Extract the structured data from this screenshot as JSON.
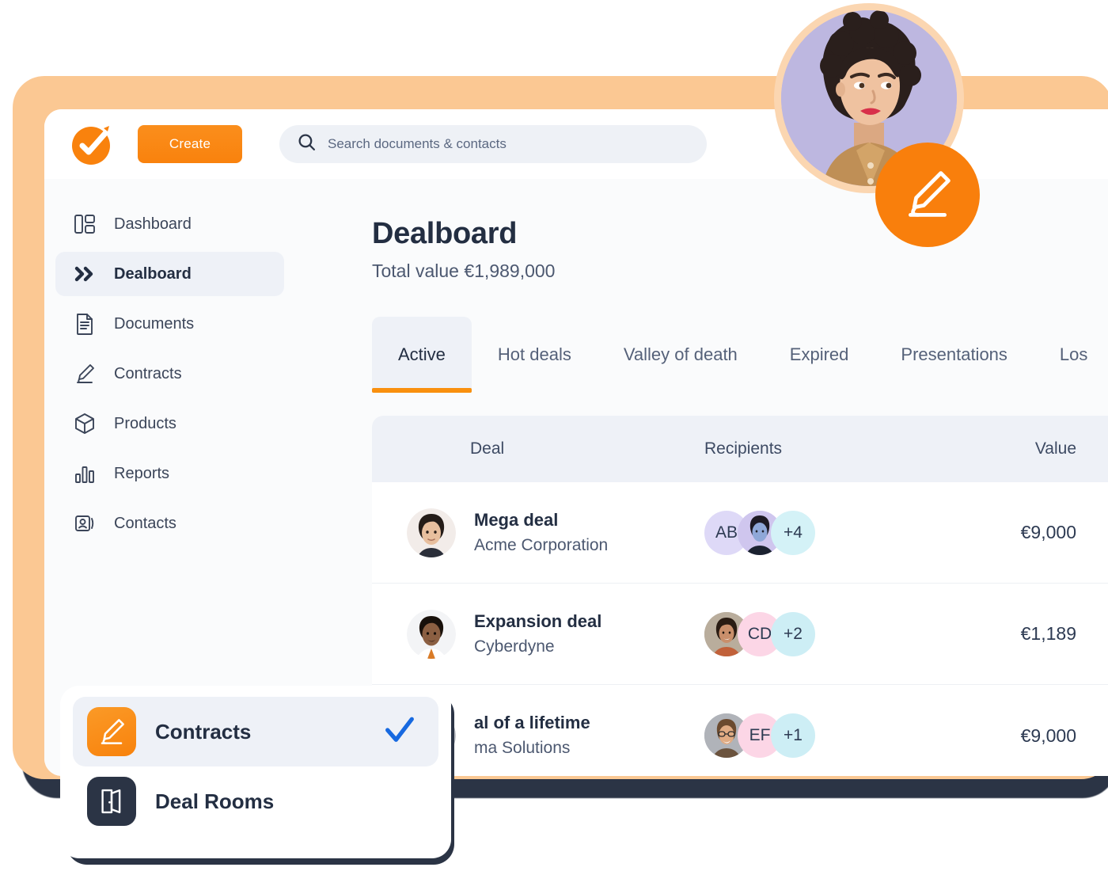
{
  "brand": {
    "accent_orange": "#f9820d",
    "frame_peach": "#fbc893",
    "dark_navy": "#2b3445",
    "logo_name": "check-logo"
  },
  "topbar": {
    "create_label": "Create",
    "search": {
      "placeholder": "Search documents & contacts",
      "icon": "search-icon"
    },
    "avatar_alt": "user-avatar",
    "fab_icon": "signature-pencil-icon"
  },
  "sidebar": {
    "items": [
      {
        "label": "Dashboard",
        "icon": "dashboard-icon",
        "active": false
      },
      {
        "label": "Dealboard",
        "icon": "chevrons-right-icon",
        "active": true
      },
      {
        "label": "Documents",
        "icon": "document-icon",
        "active": false
      },
      {
        "label": "Contracts",
        "icon": "signature-pencil-icon",
        "active": false
      },
      {
        "label": "Products",
        "icon": "cube-icon",
        "active": false
      },
      {
        "label": "Reports",
        "icon": "bar-chart-icon",
        "active": false
      },
      {
        "label": "Contacts",
        "icon": "contact-card-icon",
        "active": false
      }
    ]
  },
  "main": {
    "title": "Dealboard",
    "subtitle": "Total value €1,989,000",
    "tabs": [
      {
        "label": "Active",
        "active": true
      },
      {
        "label": "Hot deals",
        "active": false
      },
      {
        "label": "Valley of death",
        "active": false
      },
      {
        "label": "Expired",
        "active": false
      },
      {
        "label": "Presentations",
        "active": false
      },
      {
        "label": "Los",
        "active": false
      }
    ],
    "table": {
      "columns": [
        "Deal",
        "Recipients",
        "Value"
      ],
      "rows": [
        {
          "deal": "Mega deal",
          "company": "Acme Corporation",
          "value": "€9,000",
          "avatar": "photo-asian-woman",
          "recipients": [
            {
              "type": "initials",
              "label": "AB",
              "color": "#ded9f7"
            },
            {
              "type": "photo",
              "label": "",
              "color": "#cfc6ee"
            },
            {
              "type": "count",
              "label": "+4",
              "color": "#d4f2f7"
            }
          ]
        },
        {
          "deal": "Expansion deal",
          "company": "Cyberdyne",
          "value": "€1,189",
          "avatar": "photo-man-dark-hair",
          "recipients": [
            {
              "type": "photo",
              "label": "",
              "color": "#cbbfae"
            },
            {
              "type": "initials",
              "label": "CD",
              "color": "#fcd6e6"
            },
            {
              "type": "count",
              "label": "+2",
              "color": "#cdeef5"
            }
          ]
        },
        {
          "deal": "al of a lifetime",
          "company": "ma Solutions",
          "value": "€9,000",
          "avatar": "photo-man-glasses",
          "recipients": [
            {
              "type": "photo",
              "label": "",
              "color": "#b9bcc2"
            },
            {
              "type": "initials",
              "label": "EF",
              "color": "#fcd6e6"
            },
            {
              "type": "count",
              "label": "+1",
              "color": "#cdeef5"
            }
          ]
        }
      ]
    }
  },
  "popup": {
    "items": [
      {
        "label": "Contracts",
        "icon": "signature-pencil-icon",
        "selected": true,
        "check_icon": "check-icon"
      },
      {
        "label": "Deal Rooms",
        "icon": "open-door-icon",
        "selected": false,
        "check_icon": ""
      }
    ]
  }
}
